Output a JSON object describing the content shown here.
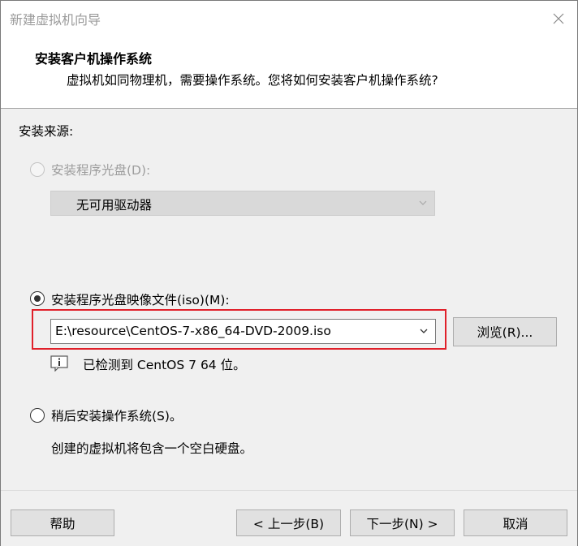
{
  "window": {
    "title": "新建虚拟机向导",
    "close_icon": "close-icon"
  },
  "header": {
    "title": "安装客户机操作系统",
    "subtitle": "虚拟机如同物理机，需要操作系统。您将如何安装客户机操作系统?"
  },
  "install_source": {
    "label": "安装来源:",
    "options": [
      {
        "label": "安装程序光盘(D):",
        "selected": false,
        "enabled": false,
        "combo_value": "无可用驱动器"
      },
      {
        "label": "安装程序光盘映像文件(iso)(M):",
        "selected": true,
        "enabled": true,
        "combo_value": "E:\\resource\\CentOS-7-x86_64-DVD-2009.iso",
        "browse_label": "浏览(R)...",
        "detection_text": "已检测到 CentOS 7 64 位。"
      },
      {
        "label": "稍后安装操作系统(S)。",
        "selected": false,
        "enabled": true,
        "description": "创建的虚拟机将包含一个空白硬盘。"
      }
    ]
  },
  "footer": {
    "help_label": "帮助",
    "back_label": "< 上一步(B)",
    "next_label": "下一步(N) >",
    "cancel_label": "取消"
  },
  "colors": {
    "highlight_border": "#e0202a",
    "panel_background": "#f0f0f0",
    "button_face": "#e1e1e1"
  }
}
